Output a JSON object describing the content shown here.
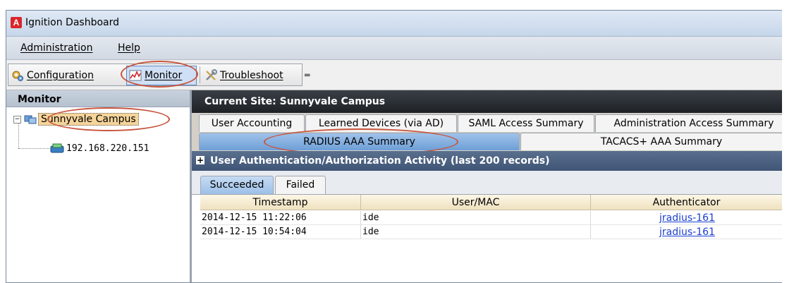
{
  "window": {
    "title": "Ignition Dashboard"
  },
  "menubar": {
    "items": [
      {
        "label": "Administration"
      },
      {
        "label": "Help"
      }
    ]
  },
  "toolbar": {
    "configuration_label": "Configuration",
    "monitor_label": "Monitor",
    "troubleshoot_label": "Troubleshoot"
  },
  "left_panel": {
    "header": "Monitor",
    "tree": {
      "site": "Sunnyvale Campus",
      "device": "192.168.220.151"
    }
  },
  "main": {
    "current_site_label": "Current Site:",
    "current_site": "Sunnyvale Campus",
    "top_tabs": [
      {
        "label": "User Accounting"
      },
      {
        "label": "Learned Devices (via AD)"
      },
      {
        "label": "SAML Access Summary"
      },
      {
        "label": "Administration Access Summary"
      }
    ],
    "second_tabs": [
      {
        "label": "RADIUS AAA Summary",
        "selected": true
      },
      {
        "label": "TACACS+ AAA Summary",
        "selected": false
      }
    ],
    "section_title": "User Authentication/Authorization Activity (last 200 records)",
    "status_tabs": [
      {
        "label": "Succeeded",
        "selected": true
      },
      {
        "label": "Failed",
        "selected": false
      }
    ],
    "table": {
      "columns": [
        "Timestamp",
        "User/MAC",
        "Authenticator"
      ],
      "rows": [
        {
          "timestamp": "2014-12-15 11:22:06",
          "user": "ide",
          "authenticator": "jradius-161"
        },
        {
          "timestamp": "2014-12-15 10:54:04",
          "user": "ide",
          "authenticator": "jradius-161"
        }
      ]
    }
  },
  "colors": {
    "annotation_ring": "#c8553d",
    "selected_tab": "#6e9fd6",
    "site_bar": "#1e2227",
    "section_bar": "#3f5575",
    "link": "#1a3fd0"
  }
}
